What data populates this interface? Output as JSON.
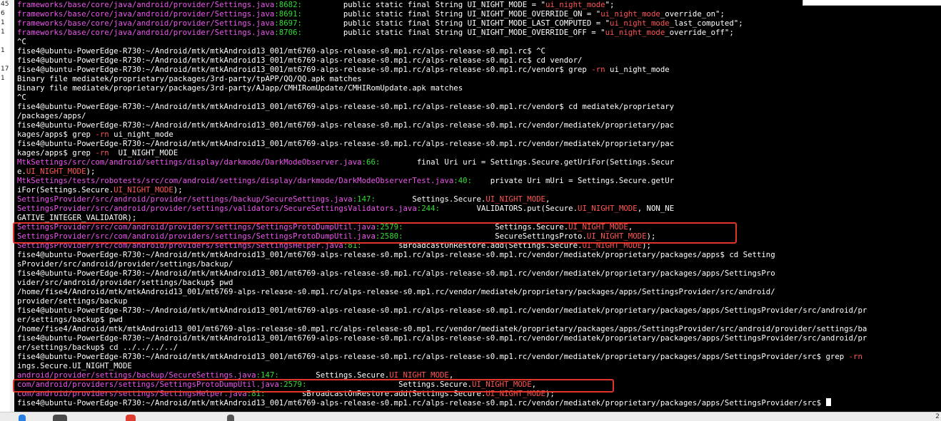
{
  "gutter": [
    "45",
    "6",
    "1",
    "1",
    "1",
    "17",
    "1"
  ],
  "lines": [
    [
      [
        "m",
        "frameworks/base/core/java/android/provider/Settings.java"
      ],
      [
        "g",
        ":8682:"
      ],
      [
        "w",
        "         public static final String UI_NIGHT_MODE = \""
      ],
      [
        "r",
        "ui_night_mode"
      ],
      [
        "w",
        "\";"
      ]
    ],
    [
      [
        "m",
        "frameworks/base/core/java/android/provider/Settings.java"
      ],
      [
        "g",
        ":8691:"
      ],
      [
        "w",
        "         public static final String UI_NIGHT_MODE_OVERRIDE_ON = \""
      ],
      [
        "r",
        "ui_night_mode"
      ],
      [
        "w",
        "_override_on\";"
      ]
    ],
    [
      [
        "m",
        "frameworks/base/core/java/android/provider/Settings.java"
      ],
      [
        "g",
        ":8697:"
      ],
      [
        "w",
        "         public static final String UI_NIGHT_MODE_LAST_COMPUTED = \""
      ],
      [
        "r",
        "ui_night_mode"
      ],
      [
        "w",
        "_last_computed\";"
      ]
    ],
    [
      [
        "m",
        "frameworks/base/core/java/android/provider/Settings.java"
      ],
      [
        "g",
        ":8706:"
      ],
      [
        "w",
        "         public static final String UI_NIGHT_MODE_OVERRIDE_OFF = \""
      ],
      [
        "r",
        "ui_night_mode"
      ],
      [
        "w",
        "_override_off\";"
      ]
    ],
    [
      [
        "w",
        "^C"
      ]
    ],
    [
      [
        "w",
        "fise4@ubuntu-PowerEdge-R730:~/Android/mtk/mtkAndroid13_001/mt6769-alps-release-s0.mp1.rc/alps-release-s0.mp1.rc$ ^C"
      ]
    ],
    [
      [
        "w",
        "fise4@ubuntu-PowerEdge-R730:~/Android/mtk/mtkAndroid13_001/mt6769-alps-release-s0.mp1.rc/alps-release-s0.mp1.rc$ cd vendor/"
      ]
    ],
    [
      [
        "w",
        "fise4@ubuntu-PowerEdge-R730:~/Android/mtk/mtkAndroid13_001/mt6769-alps-release-s0.mp1.rc/alps-release-s0.mp1.rc/vendor$ grep "
      ],
      [
        "r",
        "-rn"
      ],
      [
        "w",
        " ui_night_mode"
      ]
    ],
    [
      [
        "w",
        "Binary file mediatek/proprietary/packages/3rd-party/tpAPP/QQ/QQ.apk matches"
      ]
    ],
    [
      [
        "w",
        "Binary file mediatek/proprietary/packages/3rd-party/AJapp/CMHIRomUpdate/CMHIRomUpdate.apk matches"
      ]
    ],
    [
      [
        "w",
        "^C"
      ]
    ],
    [
      [
        "w",
        "fise4@ubuntu-PowerEdge-R730:~/Android/mtk/mtkAndroid13_001/mt6769-alps-release-s0.mp1.rc/alps-release-s0.mp1.rc/vendor$ cd mediatek/proprietary"
      ]
    ],
    [
      [
        "w",
        "/packages/apps/"
      ]
    ],
    [
      [
        "w",
        "fise4@ubuntu-PowerEdge-R730:~/Android/mtk/mtkAndroid13_001/mt6769-alps-release-s0.mp1.rc/alps-release-s0.mp1.rc/vendor/mediatek/proprietary/pac"
      ]
    ],
    [
      [
        "w",
        "kages/apps$ grep "
      ],
      [
        "r",
        "-rn"
      ],
      [
        "w",
        " ui_night_mode"
      ]
    ],
    [
      [
        "w",
        "fise4@ubuntu-PowerEdge-R730:~/Android/mtk/mtkAndroid13_001/mt6769-alps-release-s0.mp1.rc/alps-release-s0.mp1.rc/vendor/mediatek/proprietary/pac"
      ]
    ],
    [
      [
        "w",
        "kages/apps$ grep "
      ],
      [
        "r",
        "-rn"
      ],
      [
        "w",
        "  UI_NIGHT_MODE"
      ]
    ],
    [
      [
        "m",
        "MtkSettings/src/com/android/settings/display/darkmode/DarkModeObserver.java"
      ],
      [
        "g",
        ":66:"
      ],
      [
        "w",
        "        final Uri uri = Settings.Secure.getUriFor(Settings.Secur"
      ]
    ],
    [
      [
        "w",
        "e."
      ],
      [
        "r",
        "UI_NIGHT_MODE"
      ],
      [
        "w",
        ");"
      ]
    ],
    [
      [
        "m",
        "MtkSettings/tests/robotests/src/com/android/settings/display/darkmode/DarkModeObserverTest.java"
      ],
      [
        "g",
        ":40:"
      ],
      [
        "w",
        "    private Uri mUri = Settings.Secure.getUr"
      ]
    ],
    [
      [
        "w",
        "iFor(Settings.Secure."
      ],
      [
        "r",
        "UI_NIGHT_MODE"
      ],
      [
        "w",
        ");"
      ]
    ],
    [
      [
        "m",
        "SettingsProvider/src/android/provider/settings/backup/SecureSettings.java"
      ],
      [
        "g",
        ":147:"
      ],
      [
        "w",
        "        Settings.Secure."
      ],
      [
        "r",
        "UI_NIGHT_MODE"
      ],
      [
        "w",
        ","
      ]
    ],
    [
      [
        "m",
        "SettingsProvider/src/android/provider/settings/validators/SecureSettingsValidators.java"
      ],
      [
        "g",
        ":244:"
      ],
      [
        "w",
        "        VALIDATORS.put(Secure."
      ],
      [
        "r",
        "UI_NIGHT_MODE"
      ],
      [
        "w",
        ", NON_NE"
      ]
    ],
    [
      [
        "w",
        "GATIVE_INTEGER_VALIDATOR);"
      ]
    ],
    [
      [
        "m",
        "SettingsProvider/src/com/android/providers/settings/SettingsProtoDumpUtil.java"
      ],
      [
        "g",
        ":2579:"
      ],
      [
        "w",
        "                    Settings.Secure."
      ],
      [
        "r",
        "UI_NIGHT_MODE"
      ],
      [
        "w",
        ","
      ]
    ],
    [
      [
        "m",
        "SettingsProvider/src/com/android/providers/settings/SettingsProtoDumpUtil.java"
      ],
      [
        "g",
        ":2580:"
      ],
      [
        "w",
        "                    SecureSettingsProto."
      ],
      [
        "r",
        "UI_NIGHT_MODE"
      ],
      [
        "w",
        ");"
      ]
    ],
    [
      [
        "m",
        "SettingsProvider/src/com/android/providers/settings/SettingsHelper.java"
      ],
      [
        "g",
        ":81:"
      ],
      [
        "w",
        "        sBroadcastOnRestore.add(Settings.Secure."
      ],
      [
        "r",
        "UI_NIGHT_MODE"
      ],
      [
        "w",
        ");"
      ]
    ],
    [
      [
        "w",
        "fise4@ubuntu-PowerEdge-R730:~/Android/mtk/mtkAndroid13_001/mt6769-alps-release-s0.mp1.rc/alps-release-s0.mp1.rc/vendor/mediatek/proprietary/packages/apps$ cd Setting"
      ]
    ],
    [
      [
        "w",
        "sProvider/src/android/provider/settings/backup/"
      ]
    ],
    [
      [
        "w",
        "fise4@ubuntu-PowerEdge-R730:~/Android/mtk/mtkAndroid13_001/mt6769-alps-release-s0.mp1.rc/alps-release-s0.mp1.rc/vendor/mediatek/proprietary/packages/apps/SettingsPro"
      ]
    ],
    [
      [
        "w",
        "vider/src/android/provider/settings/backup$ pwd"
      ]
    ],
    [
      [
        "w",
        "/home/fise4/Android/mtk/mtkAndroid13_001/mt6769-alps-release-s0.mp1.rc/alps-release-s0.mp1.rc/vendor/mediatek/proprietary/packages/apps/SettingsProvider/src/android/"
      ]
    ],
    [
      [
        "w",
        "provider/settings/backup"
      ]
    ],
    [
      [
        "w",
        "fise4@ubuntu-PowerEdge-R730:~/Android/mtk/mtkAndroid13_001/mt6769-alps-release-s0.mp1.rc/alps-release-s0.mp1.rc/vendor/mediatek/proprietary/packages/apps/SettingsProvider/src/android/pr"
      ]
    ],
    [
      [
        "w",
        "er/settings/backup$ pwd"
      ]
    ],
    [
      [
        "w",
        "/home/fise4/Android/mtk/mtkAndroid13_001/mt6769-alps-release-s0.mp1.rc/alps-release-s0.mp1.rc/vendor/mediatek/proprietary/packages/apps/SettingsProvider/src/android/provider/settings/ba"
      ]
    ],
    [
      [
        "w",
        "fise4@ubuntu-PowerEdge-R730:~/Android/mtk/mtkAndroid13_001/mt6769-alps-release-s0.mp1.rc/alps-release-s0.mp1.rc/vendor/mediatek/proprietary/packages/apps/SettingsProvider/src/android/pr"
      ]
    ],
    [
      [
        "w",
        "er/settings/backup$ cd ../../../../"
      ]
    ],
    [
      [
        "w",
        "fise4@ubuntu-PowerEdge-R730:~/Android/mtk/mtkAndroid13_001/mt6769-alps-release-s0.mp1.rc/alps-release-s0.mp1.rc/vendor/mediatek/proprietary/packages/apps/SettingsProvider/src$ grep "
      ],
      [
        "r",
        "-rn"
      ]
    ],
    [
      [
        "w",
        "ings.Secure.UI_NIGHT_MODE"
      ]
    ],
    [
      [
        "m",
        "android/provider/settings/backup/SecureSettings.java"
      ],
      [
        "g",
        ":147:"
      ],
      [
        "w",
        "        Settings.Secure."
      ],
      [
        "r",
        "UI_NIGHT_MODE"
      ],
      [
        "w",
        ","
      ]
    ],
    [
      [
        "m",
        "com/android/providers/settings/SettingsProtoDumpUtil.java"
      ],
      [
        "g",
        ":2579:"
      ],
      [
        "w",
        "                    Settings.Secure."
      ],
      [
        "r",
        "UI_NIGHT_MODE"
      ],
      [
        "w",
        ","
      ]
    ],
    [
      [
        "m",
        "com/android/providers/settings/SettingsHelper.java"
      ],
      [
        "g",
        ":81:"
      ],
      [
        "w",
        "        sBroadcastOnRestore.add(Settings.Secure."
      ],
      [
        "r",
        "UI_NIGHT_MODE"
      ],
      [
        "w",
        ");"
      ]
    ],
    [
      [
        "w",
        "fise4@ubuntu-PowerEdge-R730:~/Android/mtk/mtkAndroid13_001/mt6769-alps-release-s0.mp1.rc/alps-release-s0.mp1.rc/vendor/mediatek/proprietary/packages/apps/SettingsProvider/src$ "
      ]
    ]
  ],
  "colors": {
    "path": "#ee55ee",
    "line_number": "#33dd33",
    "match": "#ff5555",
    "text": "#ffffff",
    "highlight_box": "#e0352b"
  },
  "taskbar": {
    "clock": "2"
  }
}
